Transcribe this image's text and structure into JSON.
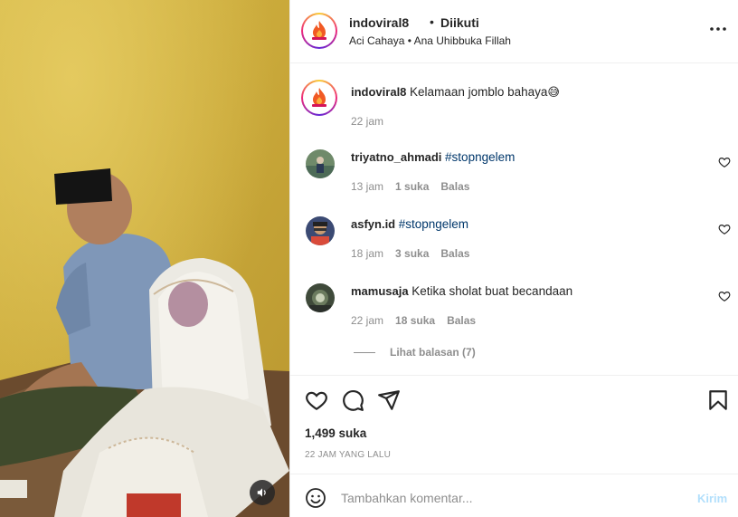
{
  "header": {
    "username": "indoviral8",
    "separator": "•",
    "follow_status": "Diikuti",
    "audio": "Aci Cahaya • Ana Uhibbuka Fillah",
    "more_icon": "more-horizontal-icon"
  },
  "caption": {
    "username": "indoviral8",
    "text": "Kelamaan jomblo bahaya",
    "emoji": "😅",
    "time": "22 jam"
  },
  "comments": [
    {
      "username": "triyatno_ahmadi",
      "text": "#stopngelem",
      "time": "13 jam",
      "likes": "1 suka",
      "reply": "Balas"
    },
    {
      "username": "asfyn.id",
      "text": "#stopngelem",
      "time": "18 jam",
      "likes": "3 suka",
      "reply": "Balas"
    },
    {
      "username": "mamusaja",
      "text": "Ketika sholat buat becandaan",
      "time": "22 jam",
      "likes": "18 suka",
      "reply": "Balas"
    }
  ],
  "view_replies": "Lihat balasan (7)",
  "actions": {
    "like_icon": "heart-icon",
    "comment_icon": "comment-icon",
    "share_icon": "send-icon",
    "save_icon": "bookmark-icon"
  },
  "likes": "1,499 suka",
  "timestamp": "22 JAM YANG LALU",
  "composer": {
    "placeholder": "Tambahkan komentar...",
    "post_label": "Kirim",
    "emoji_icon": "smiley-icon"
  },
  "media": {
    "audio_icon": "speaker-icon"
  },
  "colors": {
    "link": "#00376b",
    "muted": "#8e8e8e",
    "post_disabled": "#b2dffc"
  }
}
